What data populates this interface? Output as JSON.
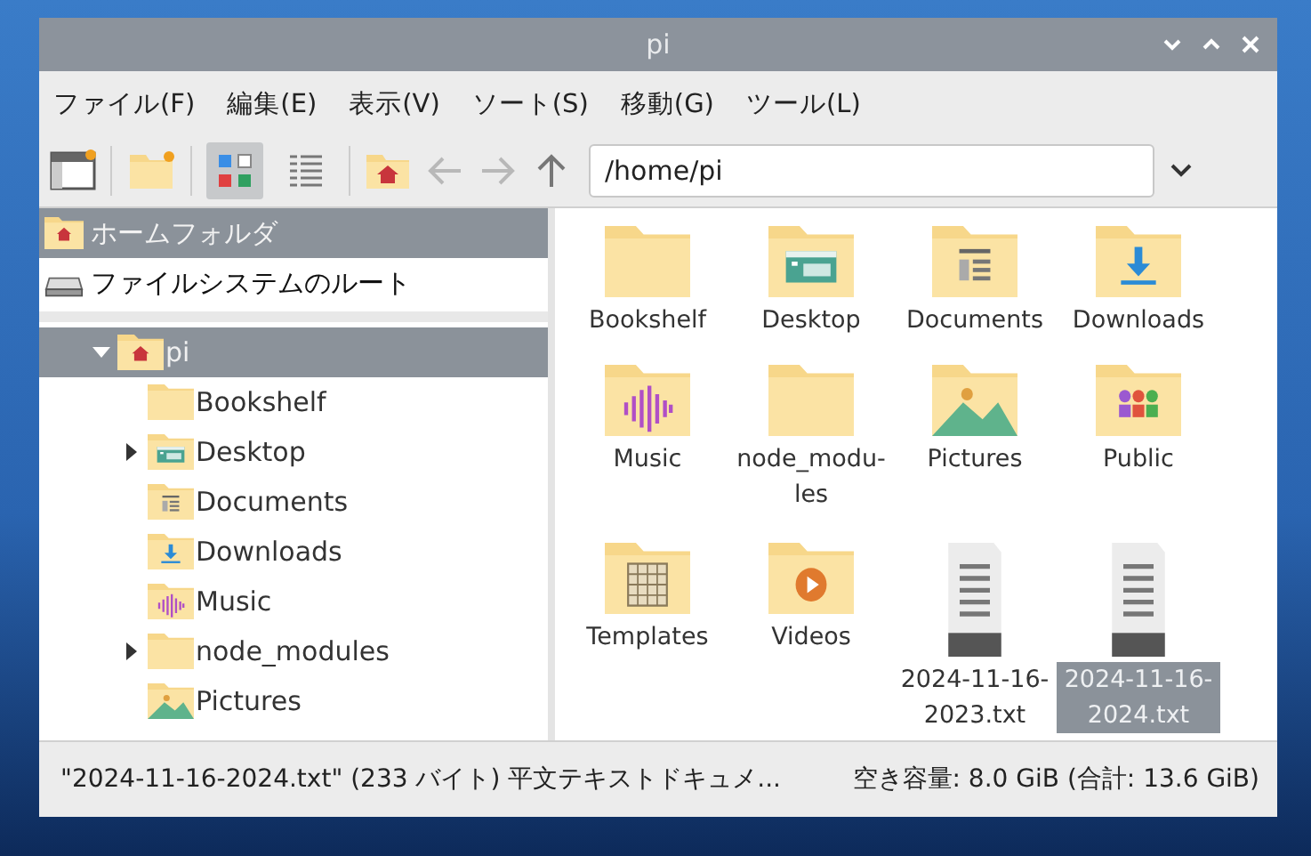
{
  "window": {
    "title": "pi"
  },
  "menu": [
    "ファイル(F)",
    "編集(E)",
    "表示(V)",
    "ソート(S)",
    "移動(G)",
    "ツール(L)"
  ],
  "toolbar": {
    "view_modes": [
      {
        "kind": "icons",
        "selected": true
      },
      {
        "kind": "list",
        "selected": false
      }
    ],
    "nav": [
      {
        "kind": "back",
        "disabled": true
      },
      {
        "kind": "forward",
        "disabled": true
      },
      {
        "kind": "up",
        "disabled": false
      }
    ],
    "path": "/home/pi"
  },
  "places": [
    {
      "label": "ホームフォルダ",
      "kind": "home",
      "selected": true
    },
    {
      "label": "ファイルシステムのルート",
      "kind": "drive",
      "selected": false
    }
  ],
  "tree": [
    {
      "label": "pi",
      "kind": "home",
      "expanded": true,
      "selected": true,
      "children": [
        {
          "label": "Bookshelf",
          "kind": "folder",
          "expandable": false,
          "selected": false
        },
        {
          "label": "Desktop",
          "kind": "desktop",
          "expandable": true,
          "selected": false
        },
        {
          "label": "Documents",
          "kind": "documents",
          "expandable": false,
          "selected": false
        },
        {
          "label": "Downloads",
          "kind": "downloads",
          "expandable": false,
          "selected": false
        },
        {
          "label": "Music",
          "kind": "music",
          "expandable": false,
          "selected": false
        },
        {
          "label": "node_modules",
          "kind": "folder",
          "expandable": true,
          "selected": false
        },
        {
          "label": "Pictures",
          "kind": "pictures",
          "expandable": false,
          "selected": false
        }
      ]
    }
  ],
  "files": [
    {
      "name": "Bookshelf",
      "kind": "folder",
      "selected": false
    },
    {
      "name": "Desktop",
      "kind": "desktop",
      "selected": false
    },
    {
      "name": "Documents",
      "kind": "documents",
      "selected": false
    },
    {
      "name": "Downloads",
      "kind": "downloads",
      "selected": false
    },
    {
      "name": "Music",
      "kind": "music",
      "selected": false
    },
    {
      "name": "node_modu-les",
      "kind": "folder",
      "selected": false
    },
    {
      "name": "Pictures",
      "kind": "pictures",
      "selected": false
    },
    {
      "name": "Public",
      "kind": "public",
      "selected": false
    },
    {
      "name": "Templates",
      "kind": "templates",
      "selected": false
    },
    {
      "name": "Videos",
      "kind": "videos",
      "selected": false
    },
    {
      "name": "2024-11-16-2023.txt",
      "kind": "text",
      "selected": false
    },
    {
      "name": "2024-11-16-2024.txt",
      "kind": "text",
      "selected": true
    }
  ],
  "status_bar": {
    "selection": "\"2024-11-16-2024.txt\" (233 バイト) 平文テキストドキュメ...",
    "space": "空き容量: 8.0 GiB (合計: 13.6 GiB)"
  }
}
